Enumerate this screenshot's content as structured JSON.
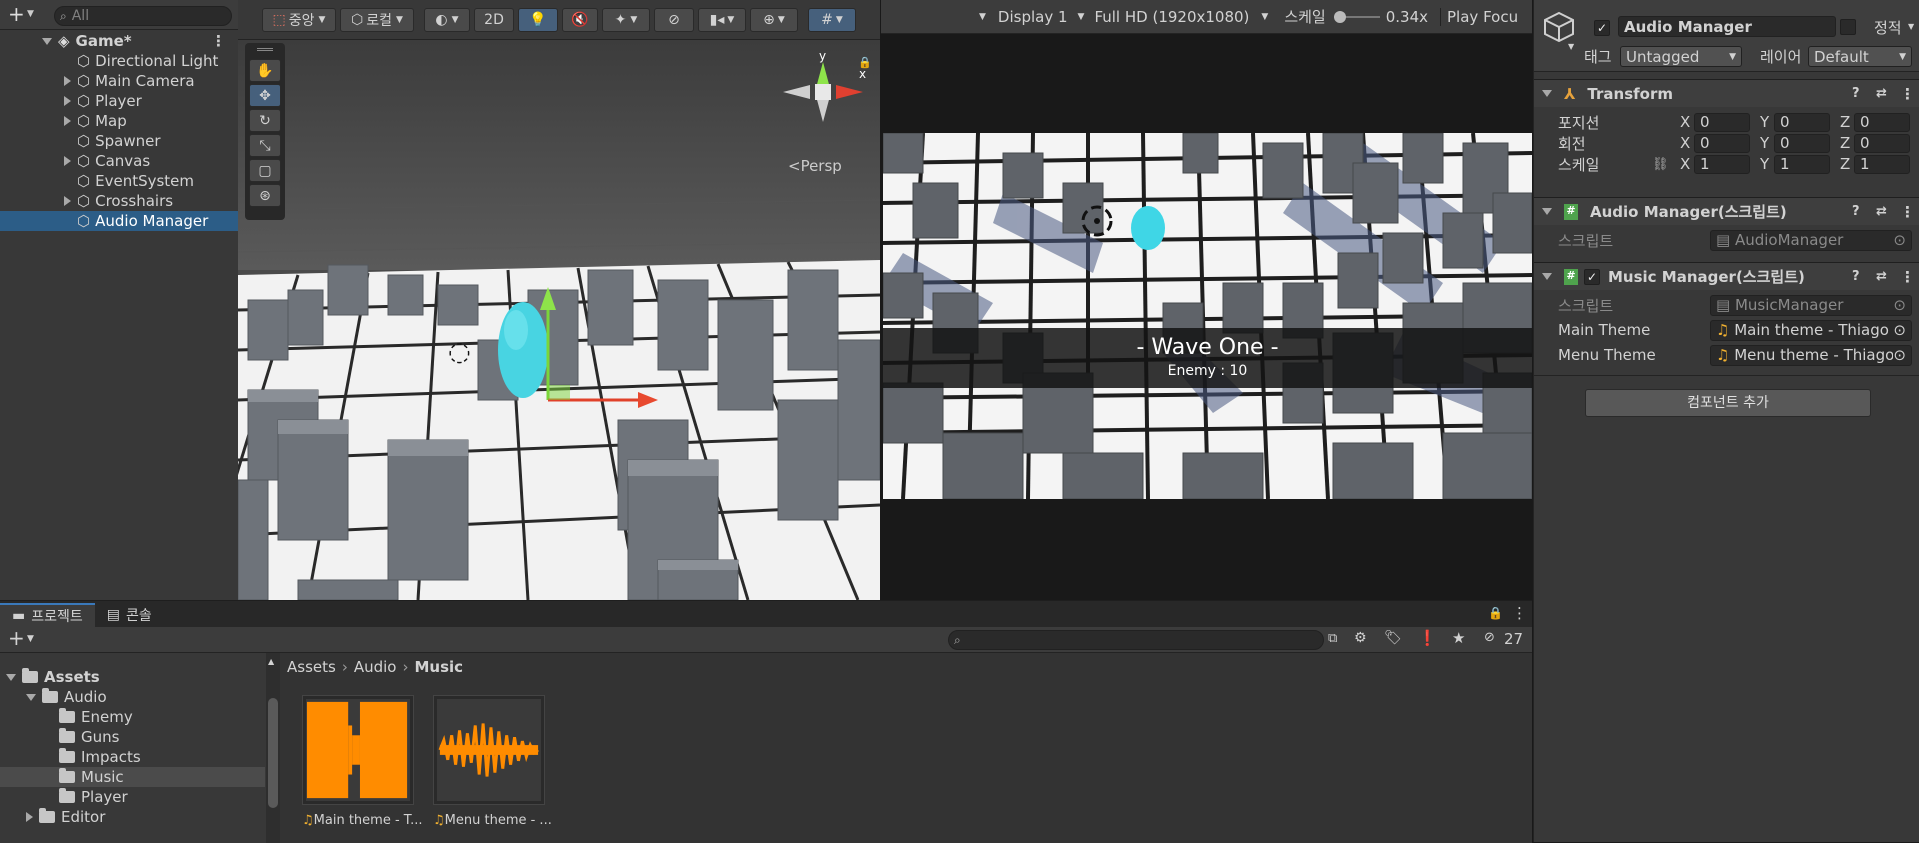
{
  "hierarchy": {
    "add_label": "+",
    "search_placeholder": "All",
    "scene": "Game*",
    "items": [
      {
        "label": "Directional Light",
        "expandable": false
      },
      {
        "label": "Main Camera",
        "expandable": true
      },
      {
        "label": "Player",
        "expandable": true
      },
      {
        "label": "Map",
        "expandable": true
      },
      {
        "label": "Spawner",
        "expandable": false
      },
      {
        "label": "Canvas",
        "expandable": true
      },
      {
        "label": "EventSystem",
        "expandable": false
      },
      {
        "label": "Crosshairs",
        "expandable": true
      },
      {
        "label": "Audio Manager",
        "expandable": false,
        "selected": true
      }
    ]
  },
  "scene_toolbar": {
    "pivot": "중앙",
    "space": "로컬",
    "mode_2d": "2D",
    "persp": "<Persp",
    "axis_x": "x",
    "axis_y": "y"
  },
  "game_toolbar": {
    "display": "Display 1",
    "resolution": "Full HD (1920x1080)",
    "scale_label": "스케일",
    "scale_value": "0.34x",
    "play_focus": "Play Focu"
  },
  "game_view": {
    "wave_title": "- Wave One -",
    "enemy_text": "Enemy : 10"
  },
  "inspector": {
    "object_name": "Audio Manager",
    "static_label": "정적",
    "tag_label": "태그",
    "tag_value": "Untagged",
    "layer_label": "레이어",
    "layer_value": "Default",
    "transform": {
      "title": "Transform",
      "rows": [
        {
          "label": "포지션",
          "x": "0",
          "y": "0",
          "z": "0"
        },
        {
          "label": "회전",
          "x": "0",
          "y": "0",
          "z": "0"
        },
        {
          "label": "스케일",
          "x": "1",
          "y": "1",
          "z": "1"
        }
      ]
    },
    "audio_manager": {
      "title": "Audio Manager(스크립트)",
      "script_label": "스크립트",
      "script_value": "AudioManager"
    },
    "music_manager": {
      "title": "Music Manager(스크립트)",
      "script_label": "스크립트",
      "script_value": "MusicManager",
      "main_theme_label": "Main Theme",
      "main_theme_value": "Main theme - Thiago A",
      "menu_theme_label": "Menu Theme",
      "menu_theme_value": "Menu theme - Thiago ."
    },
    "add_component": "컴포넌트 추가"
  },
  "project": {
    "tab_project": "프로젝트",
    "tab_console": "콘솔",
    "hidden_count": "27",
    "tree": [
      {
        "label": "Assets",
        "depth": 0,
        "bold": true,
        "open": true
      },
      {
        "label": "Audio",
        "depth": 1,
        "open": true
      },
      {
        "label": "Enemy",
        "depth": 2
      },
      {
        "label": "Guns",
        "depth": 2
      },
      {
        "label": "Impacts",
        "depth": 2
      },
      {
        "label": "Music",
        "depth": 2,
        "selected": true
      },
      {
        "label": "Player",
        "depth": 2
      },
      {
        "label": "Editor",
        "depth": 1
      }
    ],
    "breadcrumb": [
      "Assets",
      "Audio",
      "Music"
    ],
    "assets": [
      {
        "label": "Main theme - T..."
      },
      {
        "label": "Menu theme - ..."
      }
    ]
  },
  "colors": {
    "selection": "#2c5d87",
    "waveform": "#ff8c00",
    "accent_blue": "#46607c"
  }
}
